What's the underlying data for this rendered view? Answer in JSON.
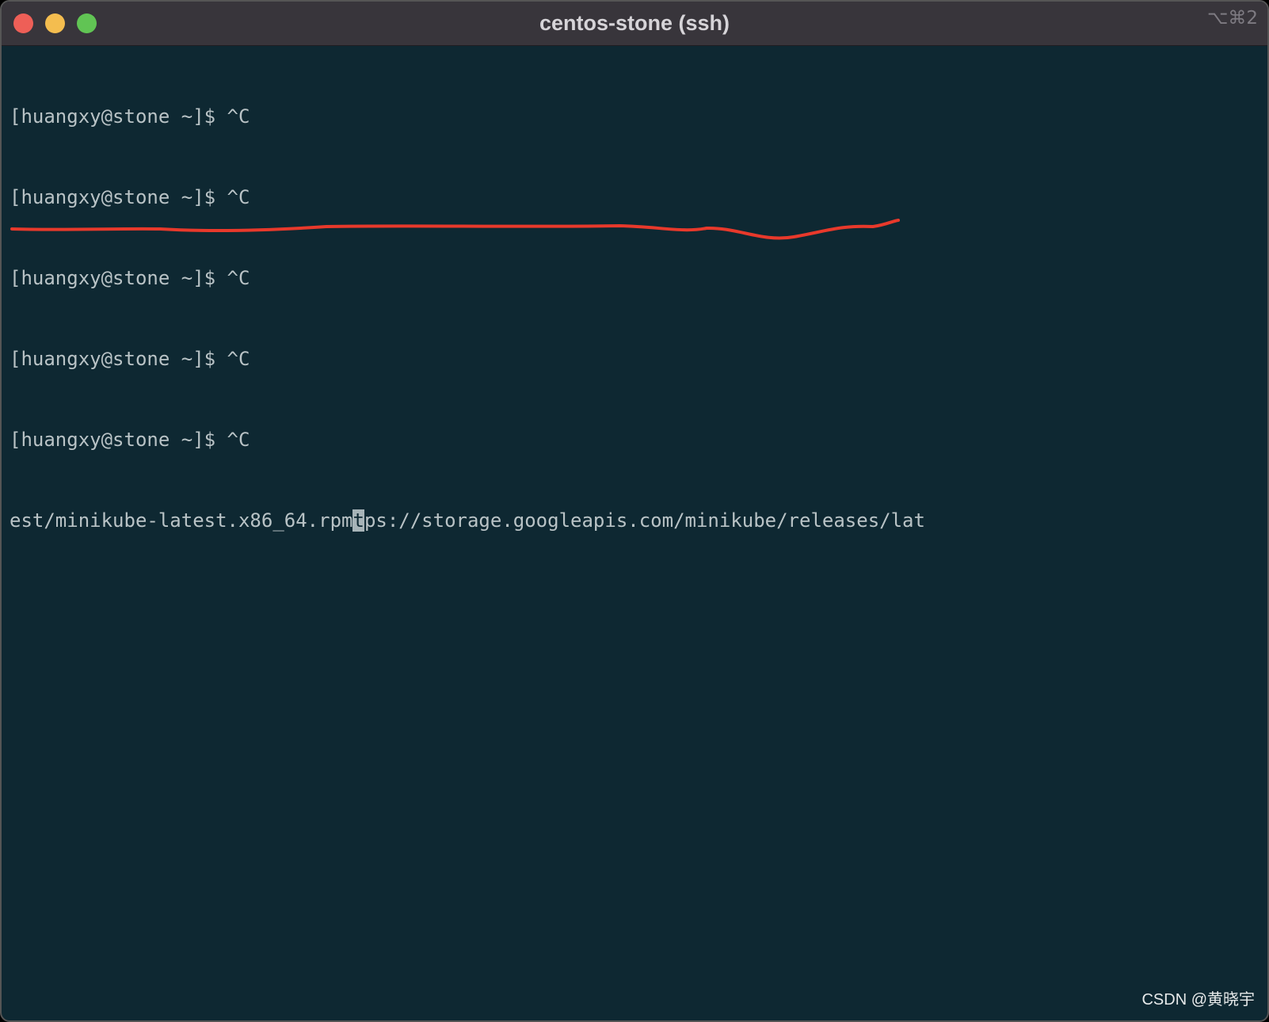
{
  "window": {
    "title": "centos-stone (ssh)",
    "shortcut": "⌥⌘2"
  },
  "terminal": {
    "prompt_lines": [
      "[huangxy@stone ~]$ ^C",
      "[huangxy@stone ~]$ ^C",
      "[huangxy@stone ~]$ ^C",
      "[huangxy@stone ~]$ ^C",
      "[huangxy@stone ~]$ ^C"
    ],
    "wrapped_line": {
      "before_cursor": "est/minikube-latest.x86_64.rpm",
      "cursor_char": "t",
      "after_cursor": "ps://storage.googleapis.com/minikube/releases/lat"
    }
  },
  "watermark": "CSDN @黄晓宇",
  "colors": {
    "background": "#0e2832",
    "text": "#b9c3c6",
    "annotation": "#e8392b"
  }
}
